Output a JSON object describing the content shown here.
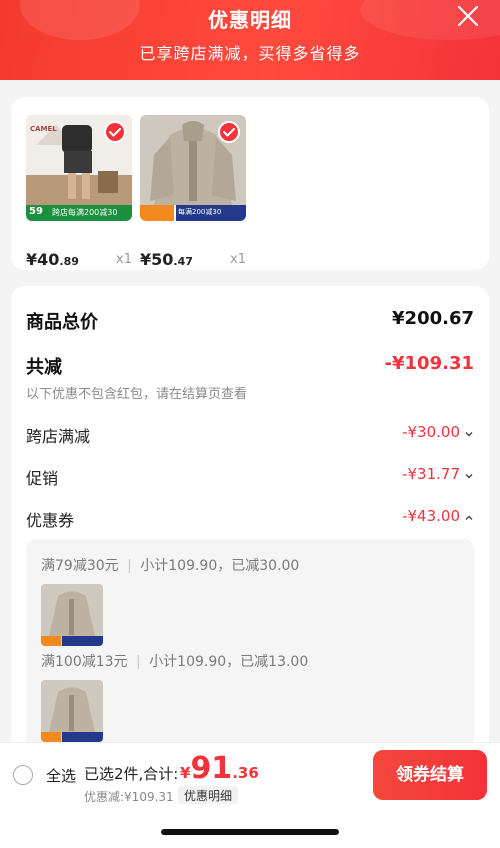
{
  "header": {
    "title": "优惠明细",
    "subtitle": "已享跨店满减，买得多省得多"
  },
  "products": [
    {
      "price_main": "¥40",
      "price_dec": ".89",
      "qty": "x1",
      "img_text": "跨店每满200减30",
      "img_badge": "59",
      "brand": "CAMEL"
    },
    {
      "price_main": "¥50",
      "price_dec": ".47",
      "qty": "x1",
      "img_text": "每满200减30",
      "img_badge": ""
    }
  ],
  "summary": {
    "total_label": "商品总价",
    "total_value": "¥200.67",
    "reduce_label": "共减",
    "reduce_value": "-¥109.31",
    "note": "以下优惠不包含红包，请在结算页查看",
    "items": [
      {
        "label": "跨店满减",
        "value": "-¥30.00",
        "chevron": "chevron-down"
      },
      {
        "label": "促销",
        "value": "-¥31.77",
        "chevron": "chevron-down"
      },
      {
        "label": "优惠券",
        "value": "-¥43.00",
        "chevron": "chevron-up"
      }
    ]
  },
  "coupons": [
    {
      "rule": "满79减30元",
      "detail": "小计109.90，已减30.00"
    },
    {
      "rule": "满100减13元",
      "detail": "小计109.90，已减13.00"
    }
  ],
  "bottom": {
    "select_all": "全选",
    "selected_text": "已选2件,合计:",
    "total_currency": "¥",
    "total_int": "91",
    "total_dec": ".36",
    "discount_text": "优惠减:¥109.31",
    "detail_chip": "优惠明细",
    "checkout_label": "领券结算"
  },
  "colors": {
    "brand_red": "#f2333a",
    "header_red": "#f43a2f"
  }
}
